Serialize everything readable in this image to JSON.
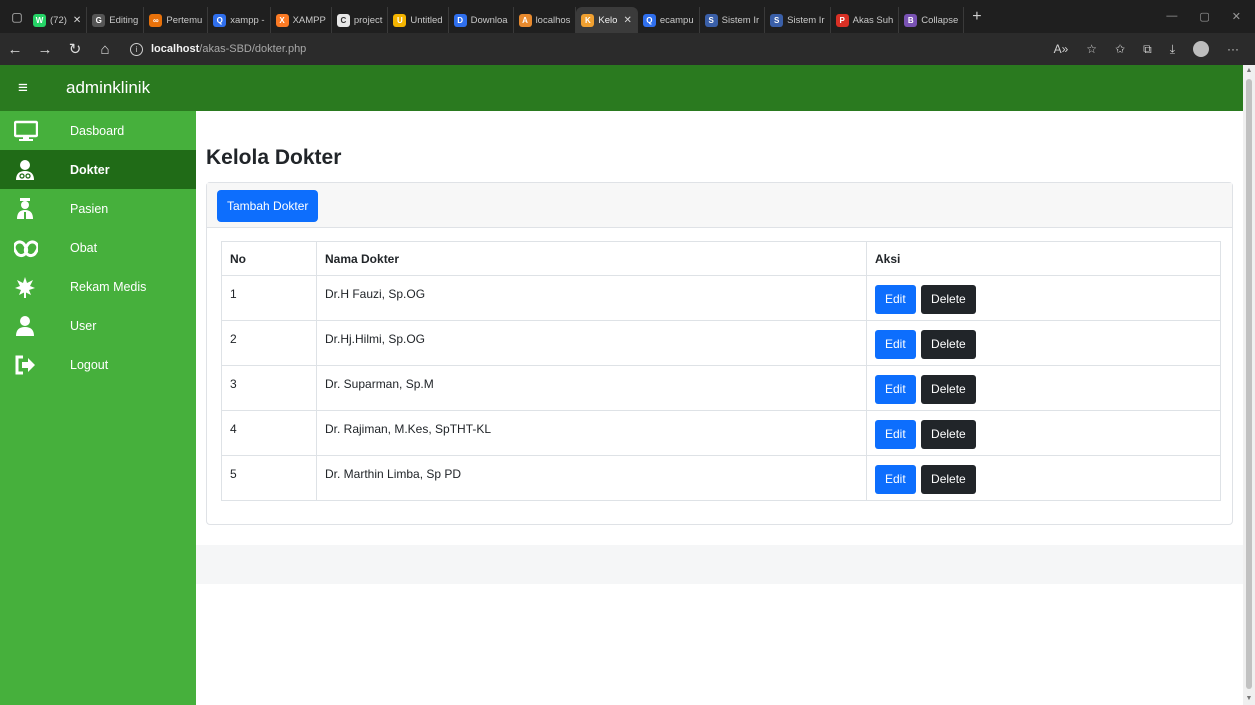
{
  "browser": {
    "tabs": [
      {
        "label": "(72)",
        "fav_char": "W",
        "fav_color": "#25d366",
        "active": false,
        "closable": true
      },
      {
        "label": "Editing",
        "fav_char": "G",
        "fav_color": "#555555",
        "active": false,
        "closable": false
      },
      {
        "label": "Pertemu",
        "fav_char": "∞",
        "fav_color": "#e8710a",
        "active": false,
        "closable": false
      },
      {
        "label": "xampp -",
        "fav_char": "Q",
        "fav_color": "#2f6fed",
        "active": false,
        "closable": false
      },
      {
        "label": "XAMPP",
        "fav_char": "X",
        "fav_color": "#fb7a24",
        "active": false,
        "closable": false
      },
      {
        "label": "project",
        "fav_char": "C",
        "fav_color": "#e8e8e8",
        "active": false,
        "closable": false
      },
      {
        "label": "Untitled",
        "fav_char": "U",
        "fav_color": "#f4b400",
        "active": false,
        "closable": false
      },
      {
        "label": "Downloa",
        "fav_char": "D",
        "fav_color": "#2f6fed",
        "active": false,
        "closable": false
      },
      {
        "label": "localhos",
        "fav_char": "A",
        "fav_color": "#e88a2e",
        "active": false,
        "closable": false
      },
      {
        "label": "Kelo",
        "fav_char": "K",
        "fav_color": "#f0a030",
        "active": true,
        "closable": true
      },
      {
        "label": "ecampu",
        "fav_char": "Q",
        "fav_color": "#2f6fed",
        "active": false,
        "closable": false
      },
      {
        "label": "Sistem Ir",
        "fav_char": "S",
        "fav_color": "#3a5fa8",
        "active": false,
        "closable": false
      },
      {
        "label": "Sistem Ir",
        "fav_char": "S",
        "fav_color": "#3a5fa8",
        "active": false,
        "closable": false
      },
      {
        "label": "Akas Suh",
        "fav_char": "P",
        "fav_color": "#d93025",
        "active": false,
        "closable": false
      },
      {
        "label": "Collapse",
        "fav_char": "B",
        "fav_color": "#7952b3",
        "active": false,
        "closable": false
      }
    ],
    "url_host": "localhost",
    "url_path": "/akas-SBD/dokter.php"
  },
  "app": {
    "brand": "adminklinik",
    "sidebar": [
      {
        "label": "Dasboard",
        "icon": "monitor-icon",
        "active": false
      },
      {
        "label": "Dokter",
        "icon": "doctor-icon",
        "active": true
      },
      {
        "label": "Pasien",
        "icon": "patient-icon",
        "active": false
      },
      {
        "label": "Obat",
        "icon": "medicine-icon",
        "active": false
      },
      {
        "label": "Rekam Medis",
        "icon": "leaf-icon",
        "active": false
      },
      {
        "label": "User",
        "icon": "user-icon",
        "active": false
      },
      {
        "label": "Logout",
        "icon": "logout-icon",
        "active": false
      }
    ],
    "page_title": "Kelola Dokter",
    "add_button": "Tambah Dokter",
    "table": {
      "headers": [
        "No",
        "Nama Dokter",
        "Aksi"
      ],
      "rows": [
        {
          "no": "1",
          "nama": "Dr.H Fauzi, Sp.OG"
        },
        {
          "no": "2",
          "nama": "Dr.Hj.Hilmi, Sp.OG"
        },
        {
          "no": "3",
          "nama": "Dr. Suparman, Sp.M"
        },
        {
          "no": "4",
          "nama": "Dr. Rajiman, M.Kes, SpTHT-KL"
        },
        {
          "no": "5",
          "nama": "Dr. Marthin Limba, Sp PD"
        }
      ],
      "edit_label": "Edit",
      "delete_label": "Delete"
    },
    "colors": {
      "topnav": "#2a7a1f",
      "sidebar": "#46b03c",
      "sidebar_active": "#206b17",
      "primary": "#0d6efd",
      "dark": "#212529"
    }
  }
}
